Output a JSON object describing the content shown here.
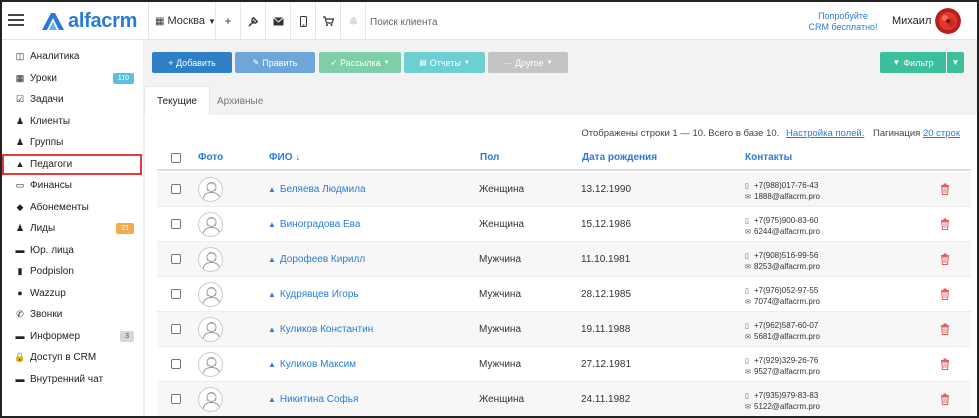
{
  "topbar": {
    "logo_text": "alfacrm",
    "city": "Москва",
    "search_placeholder": "Поиск клиента",
    "try_line1": "Попробуйте",
    "try_line2": "CRM бесплатно!",
    "user_name": "Михаил"
  },
  "sidebar": {
    "items": [
      {
        "label": "Аналитика",
        "icon": "chart-icon",
        "glyph": "◫",
        "badge": ""
      },
      {
        "label": "Уроки",
        "icon": "calendar-icon",
        "glyph": "▦",
        "badge": "110",
        "badge_color": "teal"
      },
      {
        "label": "Задачи",
        "icon": "tasks-icon",
        "glyph": "☑",
        "badge": ""
      },
      {
        "label": "Клиенты",
        "icon": "user-icon",
        "glyph": "♟",
        "badge": ""
      },
      {
        "label": "Группы",
        "icon": "group-icon",
        "glyph": "♟",
        "badge": ""
      },
      {
        "label": "Педагоги",
        "icon": "graduation-cap-icon",
        "glyph": "▲",
        "badge": "",
        "selected": true
      },
      {
        "label": "Финансы",
        "icon": "money-icon",
        "glyph": "▭",
        "badge": ""
      },
      {
        "label": "Абонементы",
        "icon": "tag-icon",
        "glyph": "◆",
        "badge": ""
      },
      {
        "label": "Лиды",
        "icon": "lead-icon",
        "glyph": "♟",
        "badge": "21",
        "badge_color": "orange"
      },
      {
        "label": "Юр. лица",
        "icon": "briefcase-icon",
        "glyph": "▬",
        "badge": ""
      },
      {
        "label": "Podpislon",
        "icon": "document-icon",
        "glyph": "▮",
        "badge": ""
      },
      {
        "label": "Wazzup",
        "icon": "whatsapp-icon",
        "glyph": "●",
        "badge": ""
      },
      {
        "label": "Звонки",
        "icon": "phone-icon",
        "glyph": "✆",
        "badge": ""
      },
      {
        "label": "Информер",
        "icon": "book-icon",
        "glyph": "▬",
        "badge": "3",
        "badge_color": "grey"
      },
      {
        "label": "Доступ в CRM",
        "icon": "lock-icon",
        "glyph": "🔒",
        "badge": ""
      },
      {
        "label": "Внутренний чат",
        "icon": "chat-icon",
        "glyph": "▬",
        "badge": ""
      }
    ]
  },
  "toolbar": {
    "add": "+ Добавить",
    "edit": "Править",
    "mailing": "Рассылка",
    "reports": "Отчеты",
    "other": "··· Другое",
    "filter": "Фильтр",
    "colors": {
      "add": "#2f7fc6",
      "edit": "#6fa6da",
      "mailing": "#7ecfa9",
      "reports": "#6cd0d2",
      "other": "#c4c4c4",
      "filter": "#3cbf9c"
    }
  },
  "tabs": {
    "current": "Текущие",
    "archive": "Архивные"
  },
  "info": {
    "text": "Отображены строки 1 — 10. Всего в базе 10.",
    "settings_link": "Настройка полей.",
    "pagination_label": "Пагинация",
    "pagination_link": "20 строк"
  },
  "table": {
    "headers": {
      "photo": "Фото",
      "name": "ФИО ↓",
      "gender": "Пол",
      "dob": "Дата рождения",
      "contacts": "Контакты"
    },
    "rows": [
      {
        "name": "Беляева Людмила",
        "gender": "Женщина",
        "dob": "13.12.1990",
        "phone": "+7(988)017-76-43",
        "email": "1888@alfacrm.pro"
      },
      {
        "name": "Виноградова Ева",
        "gender": "Женщина",
        "dob": "15.12.1986",
        "phone": "+7(975)900-83-60",
        "email": "6244@alfacrm.pro"
      },
      {
        "name": "Дорофеев Кирилл",
        "gender": "Мужчина",
        "dob": "11.10.1981",
        "phone": "+7(908)516-99-56",
        "email": "8253@alfacrm.pro"
      },
      {
        "name": "Кудрявцев Игорь",
        "gender": "Мужчина",
        "dob": "28.12.1985",
        "phone": "+7(976)052-97-55",
        "email": "7074@alfacrm.pro"
      },
      {
        "name": "Куликов Константин",
        "gender": "Мужчина",
        "dob": "19.11.1988",
        "phone": "+7(962)587-60-07",
        "email": "5681@alfacrm.pro"
      },
      {
        "name": "Куликов Максим",
        "gender": "Мужчина",
        "dob": "27.12.1981",
        "phone": "+7(929)329-26-76",
        "email": "9527@alfacrm.pro"
      },
      {
        "name": "Никитина Софья",
        "gender": "Женщина",
        "dob": "24.11.1982",
        "phone": "+7(935)979-83-83",
        "email": "5122@alfacrm.pro"
      }
    ]
  }
}
